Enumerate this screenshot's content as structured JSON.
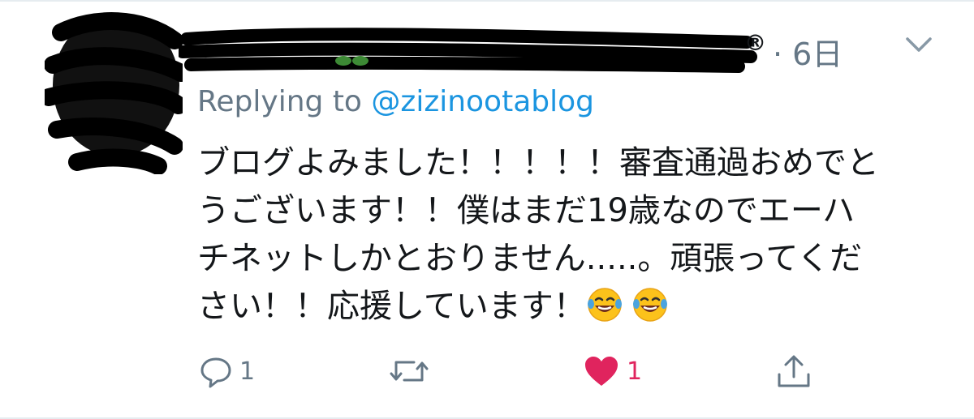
{
  "tweet": {
    "author_suffix": "®",
    "separator": " · ",
    "time": "6日",
    "replying_prefix": "Replying to",
    "replying_handle": "@zizinootablog",
    "lines": [
      "ブログよみました！！！！！審査通過おめでと",
      "うございます！！僕はまだ19歳なのでエーハ",
      "チネットしかとおりません.....。頑張ってくだ",
      "さい！！応援しています！"
    ],
    "emojis": [
      "face-with-tears-of-joy",
      "face-with-tears-of-joy"
    ]
  },
  "actions": {
    "reply_count": "1",
    "retweet_count": "",
    "like_count": "1",
    "liked": true
  },
  "colors": {
    "text": "#14171a",
    "secondary": "#657786",
    "link": "#1b95e0",
    "like": "#e0245e"
  }
}
